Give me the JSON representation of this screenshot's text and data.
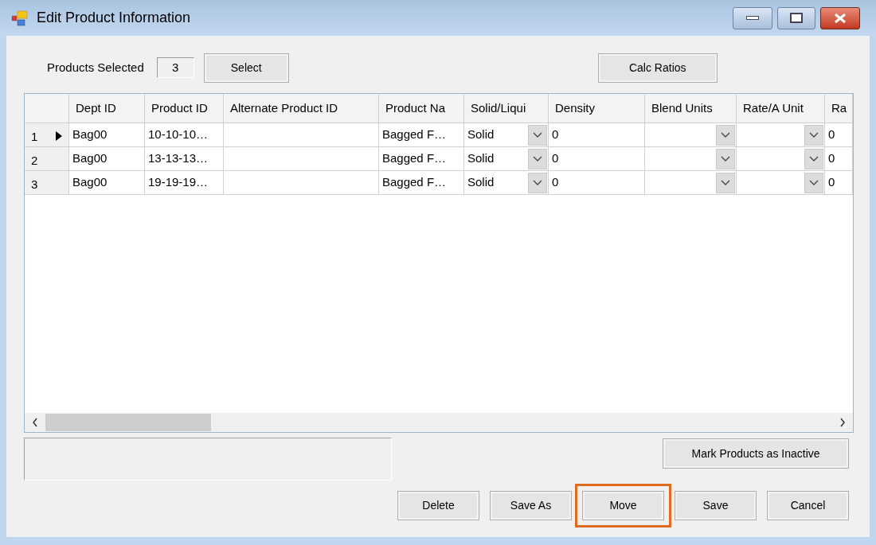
{
  "window": {
    "title": "Edit Product Information"
  },
  "products_selected": {
    "label": "Products Selected",
    "value": "3"
  },
  "top_buttons": [
    {
      "label": "Select"
    },
    {
      "label": "Calc Ratios"
    }
  ],
  "table": {
    "columns": [
      {
        "label": "Dept ID",
        "kind": "text"
      },
      {
        "label": "Product ID",
        "kind": "text"
      },
      {
        "label": "Alternate Product ID",
        "kind": "text"
      },
      {
        "label": "Product Na",
        "kind": "text"
      },
      {
        "label": "Solid/Liqui",
        "kind": "combo"
      },
      {
        "label": "Density",
        "kind": "text"
      },
      {
        "label": "Blend Units",
        "kind": "combo"
      },
      {
        "label": "Rate/A Unit",
        "kind": "combo"
      },
      {
        "label": "Ra",
        "kind": "text"
      }
    ],
    "rows": [
      {
        "number": "1",
        "current": true,
        "cells": [
          "Bag00",
          "10-10-10…",
          "",
          "Bagged F…",
          "Solid",
          "0",
          "",
          "",
          "0"
        ]
      },
      {
        "number": "2",
        "current": false,
        "cells": [
          "Bag00",
          "13-13-13…",
          "",
          "Bagged F…",
          "Solid",
          "0",
          "",
          "",
          "0"
        ]
      },
      {
        "number": "3",
        "current": false,
        "cells": [
          "Bag00",
          "19-19-19…",
          "",
          "Bagged F…",
          "Solid",
          "0",
          "",
          "",
          "0"
        ]
      }
    ]
  },
  "side_button": {
    "label": "Mark Products as Inactive"
  },
  "bottom_buttons": [
    {
      "label": "Delete",
      "highlighted": false
    },
    {
      "label": "Save As",
      "highlighted": false
    },
    {
      "label": "Move",
      "highlighted": true
    },
    {
      "label": "Save",
      "highlighted": false
    },
    {
      "label": "Cancel",
      "highlighted": false
    }
  ]
}
